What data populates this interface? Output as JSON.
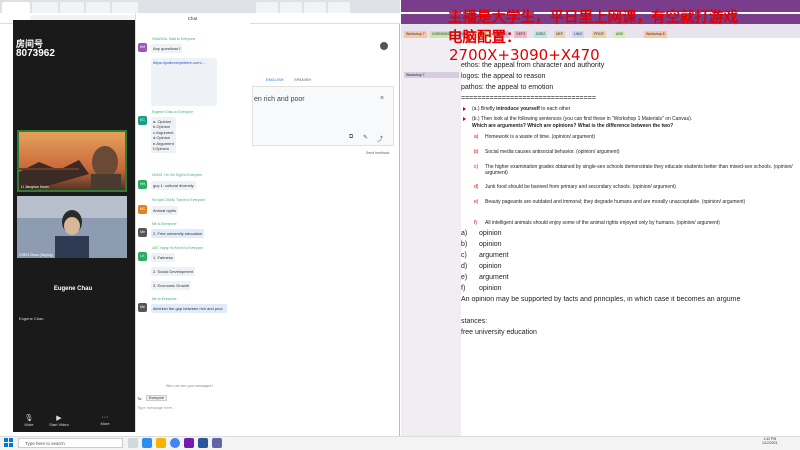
{
  "overlay": {
    "line1": "主播是大学生，平日里上网课，有空就打游戏",
    "line2": "电脑配置：",
    "line3": "2700X+3090+X470"
  },
  "zoom": {
    "room_label": "房间号",
    "room_id": "8073962",
    "video1_name": "LI Jiangtian Kevin",
    "video2_name": "CHEN Zihao (Jiaying)",
    "main_name": "Eugene Chau",
    "small_name": "Eugene Chau",
    "buttons": [
      "Mute",
      "Start Video",
      "More"
    ]
  },
  "chat": {
    "title": "Chat",
    "messages": [
      {
        "from": "HUANGA, Matt to Everyone",
        "text": "Any questions?"
      },
      {
        "from": "",
        "text": "https://polleverywhere.com/..."
      },
      {
        "from": "Eugene Chau to Everyone",
        "text": "a. Opinion\nb.Opinion\nc.Argument\nd.Opinion\ne.Argument\nf.Opinion"
      },
      {
        "from": "HUNG, Ho Chi Sigil to Everyone",
        "text": "guy 1: cultural diversity"
      },
      {
        "from": "Ho Wai CHAN, Travis to Everyone",
        "text": "Animal rights"
      },
      {
        "from": "Me to Everyone",
        "text": "2. Free university education"
      },
      {
        "from": "LEE Yiang Ho Kevin to Everyone",
        "text": "1. Fairness"
      },
      {
        "from": "",
        "text": "2. Social Development"
      },
      {
        "from": "",
        "text": "3. Economic Growth"
      },
      {
        "from": "Me to Everyone",
        "text": "diminish the gap between rich and poor"
      }
    ],
    "who_can_see": "Who can see your messages?",
    "to_label": "To:",
    "to_value": "Everyone",
    "placeholder": "Type message here..."
  },
  "behind": {
    "tab_english": "ENGLISH",
    "tab_spanish": "SPANISH",
    "text_fragment": "en rich and poor",
    "feedback": "Send feedback"
  },
  "onenote": {
    "section_tabs": [
      "Workshop 7",
      "CHEN0002",
      "DSE",
      "ELTS",
      "EAS1",
      "GEF3",
      "DSE2",
      "NEF",
      "LING",
      "PROP",
      "ASS",
      "Workshop 8"
    ],
    "page_item": "Workshop 7",
    "lines": {
      "ethos": "ethos: the appeal from character and authority",
      "logos": "logos: the appeal to reason",
      "pathos": "pathos: the appeal to emotion",
      "divider": "=================================",
      "a_task_prefix": "(a.) Briefly ",
      "a_task_bold": "introduce yourself",
      "a_task_suffix": " to each other",
      "b_task_1": "(b.) Then look at the following sentences (you can find these in \"Workshop 1 Materials\" on Canvas).",
      "b_task_2": "Which are arguments? Which are opinions? What is the difference between the two?",
      "items": [
        {
          "letter": "a)",
          "text": "Homework is a waste of time. (opinion/ argument)"
        },
        {
          "letter": "b)",
          "text": "Social media causes antisocial behavior. (opinion/ argument)"
        },
        {
          "letter": "c)",
          "text": "The higher examination grades obtained by single-sex schools demonstrate they educate students better than mixed-sex schools. (opinion/ argument)"
        },
        {
          "letter": "d)",
          "text": "Junk food should be banned from primary and secondary schools. (opinion/ argument)"
        },
        {
          "letter": "e)",
          "text": "Beauty pageants are outdated and immoral; they degrade humans and are morally unacceptable. (opinion/ argument)"
        },
        {
          "letter": "f)",
          "text": "All intelligent animals should enjoy some of the animal rights enjoyed only by humans. (opinion/ argument)"
        }
      ],
      "answers": [
        {
          "letter": "a)",
          "text": "opinion"
        },
        {
          "letter": "b)",
          "text": "opinion"
        },
        {
          "letter": "c)",
          "text": "argument"
        },
        {
          "letter": "d)",
          "text": "opinion"
        },
        {
          "letter": "e)",
          "text": "argument"
        },
        {
          "letter": "f)",
          "text": "opinion"
        }
      ],
      "support": "An opinion may be supported by facts and principles, in which case it becomes an argume",
      "stances": "stances:",
      "stance1": "free university education"
    }
  },
  "taskbar": {
    "search_placeholder": "Type here to search",
    "time": "1:42 PM",
    "date": "1/12/2021"
  }
}
